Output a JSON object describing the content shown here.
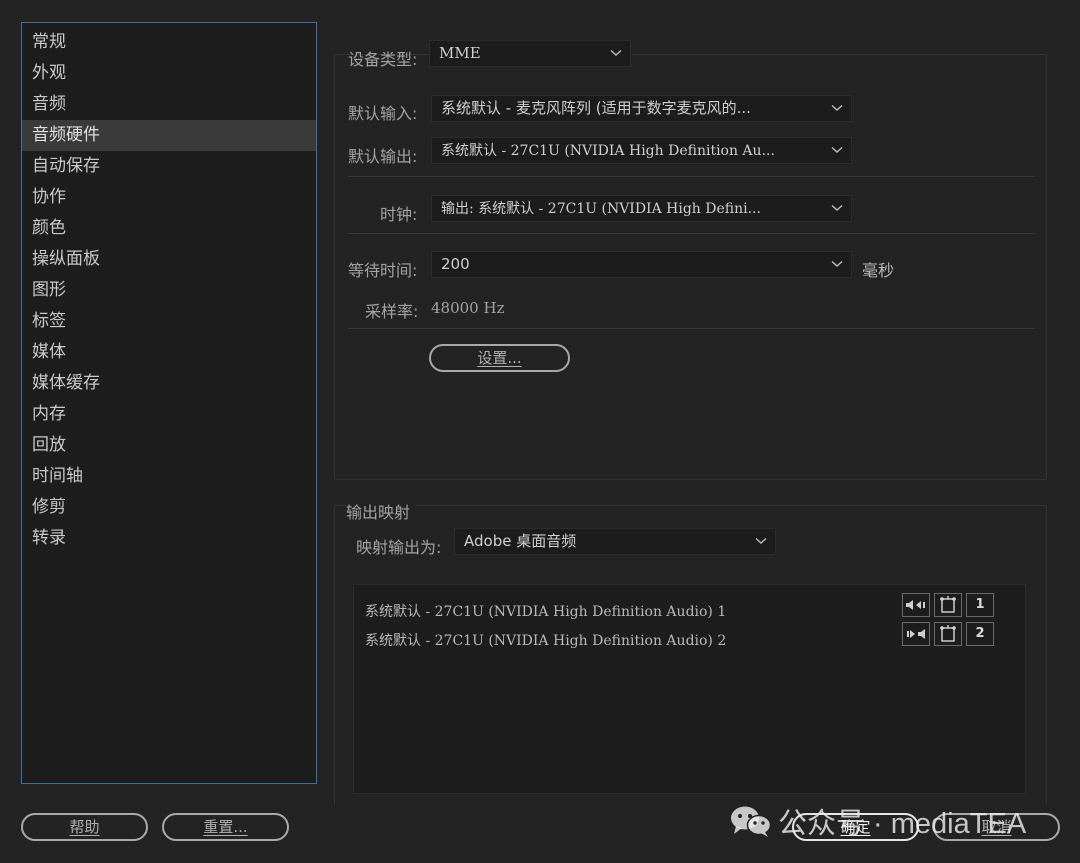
{
  "sidebar": {
    "items": [
      {
        "label": "常规"
      },
      {
        "label": "外观"
      },
      {
        "label": "音频"
      },
      {
        "label": "音频硬件"
      },
      {
        "label": "自动保存"
      },
      {
        "label": "协作"
      },
      {
        "label": "颜色"
      },
      {
        "label": "操纵面板"
      },
      {
        "label": "图形"
      },
      {
        "label": "标签"
      },
      {
        "label": "媒体"
      },
      {
        "label": "媒体缓存"
      },
      {
        "label": "内存"
      },
      {
        "label": "回放"
      },
      {
        "label": "时间轴"
      },
      {
        "label": "修剪"
      },
      {
        "label": "转录"
      }
    ],
    "selected_index": 3
  },
  "device": {
    "type_label": "设备类型:",
    "type_value": "MME",
    "default_input_label": "默认输入:",
    "default_input_value": "系统默认 - 麦克风阵列 (适用于数字麦克风的...",
    "default_output_label": "默认输出:",
    "default_output_value": "系统默认 - 27C1U (NVIDIA High Definition Au...",
    "clock_label": "时钟:",
    "clock_value": "输出: 系统默认 - 27C1U (NVIDIA High Defini...",
    "latency_label": "等待时间:",
    "latency_value": "200",
    "latency_unit": "毫秒",
    "sample_rate_label": "采样率:",
    "sample_rate_value": "48000 Hz",
    "settings_button": "设置..."
  },
  "output_mapping": {
    "section_title": "输出映射",
    "map_to_label": "映射输出为:",
    "map_to_value": "Adobe 桌面音频",
    "rows": [
      {
        "label": "系统默认 - 27C1U (NVIDIA High Definition Audio) 1",
        "channel": "1"
      },
      {
        "label": "系统默认 - 27C1U (NVIDIA High Definition Audio) 2",
        "channel": "2"
      }
    ]
  },
  "footer": {
    "help_button": "帮助",
    "reset_button": "重置...",
    "ok_button": "确定",
    "cancel_button": "取消"
  },
  "watermark": {
    "text": "公众号 · mediaTEA"
  },
  "colors": {
    "background": "#232323",
    "sidebar_border": "#3f6fa8",
    "selected_row": "#3a3a3a"
  },
  "icons": [
    "chevron-down-icon",
    "speaker-left-icon",
    "speaker-right-icon",
    "routing-icon",
    "wechat-icon"
  ]
}
